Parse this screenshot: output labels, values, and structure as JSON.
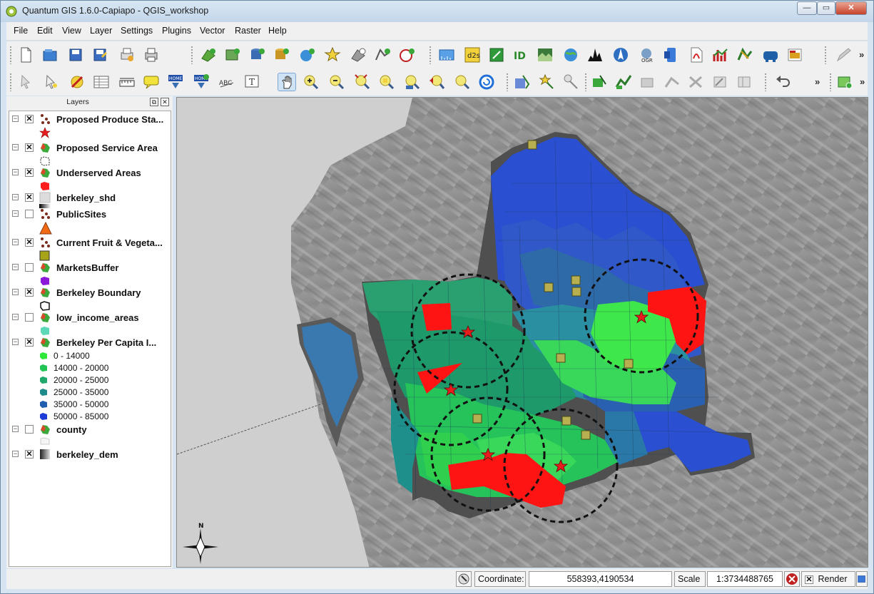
{
  "window": {
    "title": "Quantum GIS 1.6.0-Capiapo - QGIS_workshop"
  },
  "menu": [
    "File",
    "Edit",
    "View",
    "Layer",
    "Settings",
    "Plugins",
    "Vector",
    "Raster",
    "Help"
  ],
  "layers_panel": {
    "title": "Layers",
    "layers": [
      {
        "name": "Proposed Produce Sta...",
        "checked": true
      },
      {
        "name": "Proposed Service Area",
        "checked": true
      },
      {
        "name": "Underserved Areas",
        "checked": true
      },
      {
        "name": "berkeley_shd",
        "checked": true
      },
      {
        "name": "PublicSites",
        "checked": false
      },
      {
        "name": "Current Fruit & Vegeta...",
        "checked": true
      },
      {
        "name": "MarketsBuffer",
        "checked": false
      },
      {
        "name": "Berkeley Boundary",
        "checked": true
      },
      {
        "name": "low_income_areas",
        "checked": false
      },
      {
        "name": "Berkeley Per Capita I...",
        "checked": true
      },
      {
        "name": "county",
        "checked": false
      },
      {
        "name": "berkeley_dem",
        "checked": true
      }
    ],
    "income_classes": [
      {
        "label": "0 - 14000",
        "color": "#2ee83a"
      },
      {
        "label": "14000 - 20000",
        "color": "#22c455"
      },
      {
        "label": "20000 - 25000",
        "color": "#1fa86a"
      },
      {
        "label": "25000 - 35000",
        "color": "#1e8a8a"
      },
      {
        "label": "35000 - 50000",
        "color": "#1f5fae"
      },
      {
        "label": "50000 - 85000",
        "color": "#1d3bd6"
      }
    ],
    "check_mark": "✕"
  },
  "map": {
    "north_label": "N"
  },
  "statusbar": {
    "coordinate_label": "Coordinate:",
    "coordinate_value": "558393,4190534",
    "scale_label": "Scale",
    "scale_value": "1:3734488765",
    "render_label": "Render",
    "render_checked": true
  }
}
